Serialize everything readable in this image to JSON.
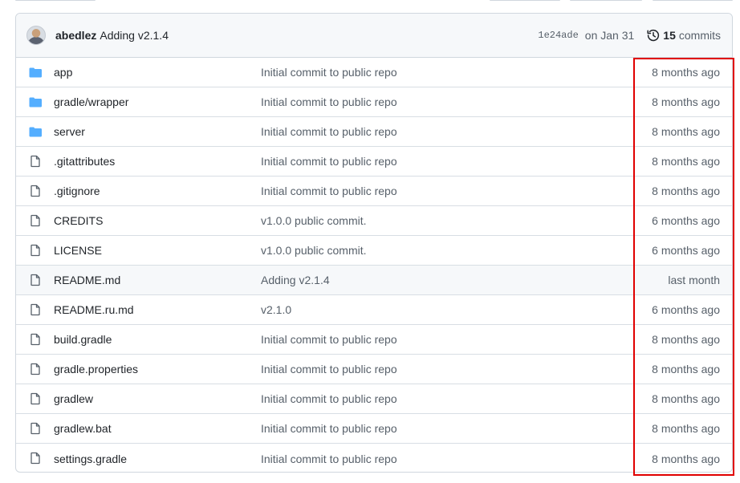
{
  "commit": {
    "author": "abedlez",
    "message": "Adding v2.1.4",
    "sha": "1e24ade",
    "date": "on Jan 31",
    "commits_count": "15",
    "commits_label": "commits"
  },
  "files": [
    {
      "name": "app",
      "type": "folder",
      "message": "Initial commit to public repo",
      "age": "8 months ago",
      "icon": "folder-icon"
    },
    {
      "name": "gradle/wrapper",
      "type": "folder",
      "message": "Initial commit to public repo",
      "age": "8 months ago",
      "icon": "folder-icon"
    },
    {
      "name": "server",
      "type": "folder",
      "message": "Initial commit to public repo",
      "age": "8 months ago",
      "icon": "folder-icon"
    },
    {
      "name": ".gitattributes",
      "type": "file",
      "message": "Initial commit to public repo",
      "age": "8 months ago",
      "icon": "file-icon"
    },
    {
      "name": ".gitignore",
      "type": "file",
      "message": "Initial commit to public repo",
      "age": "8 months ago",
      "icon": "file-icon"
    },
    {
      "name": "CREDITS",
      "type": "file",
      "message": "v1.0.0 public commit.",
      "age": "6 months ago",
      "icon": "file-icon"
    },
    {
      "name": "LICENSE",
      "type": "file",
      "message": "v1.0.0 public commit.",
      "age": "6 months ago",
      "icon": "file-icon"
    },
    {
      "name": "README.md",
      "type": "file",
      "message": "Adding v2.1.4",
      "age": "last month",
      "icon": "file-icon"
    },
    {
      "name": "README.ru.md",
      "type": "file",
      "message": "v2.1.0",
      "age": "6 months ago",
      "icon": "file-icon"
    },
    {
      "name": "build.gradle",
      "type": "file",
      "message": "Initial commit to public repo",
      "age": "8 months ago",
      "icon": "file-icon"
    },
    {
      "name": "gradle.properties",
      "type": "file",
      "message": "Initial commit to public repo",
      "age": "8 months ago",
      "icon": "file-icon"
    },
    {
      "name": "gradlew",
      "type": "file",
      "message": "Initial commit to public repo",
      "age": "8 months ago",
      "icon": "file-icon"
    },
    {
      "name": "gradlew.bat",
      "type": "file",
      "message": "Initial commit to public repo",
      "age": "8 months ago",
      "icon": "file-icon"
    },
    {
      "name": "settings.gradle",
      "type": "file",
      "message": "Initial commit to public repo",
      "age": "8 months ago",
      "icon": "file-icon"
    }
  ],
  "colors": {
    "folder": "#54aeff",
    "file_icon": "#57606a",
    "annotation": "#e00000",
    "highlight_row": "#f6f8fa"
  }
}
